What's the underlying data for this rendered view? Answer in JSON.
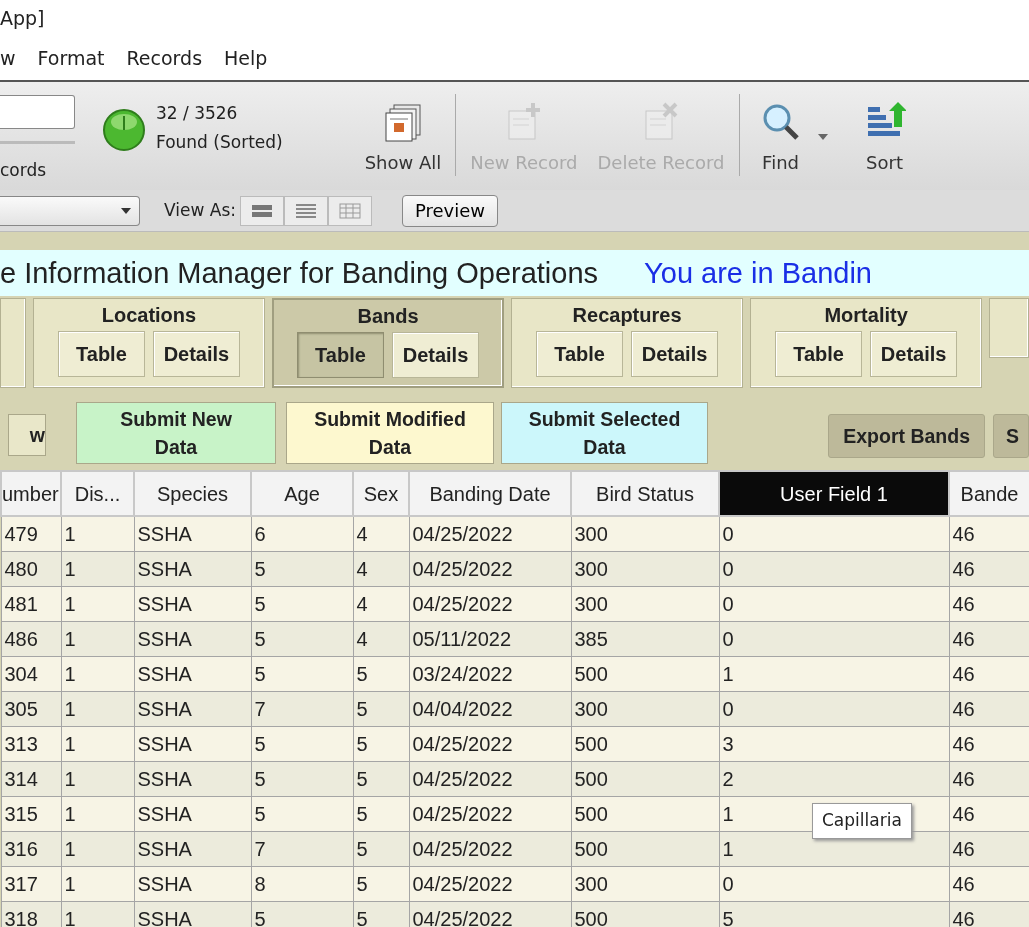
{
  "window": {
    "title": "App]"
  },
  "menu": [
    {
      "label": "w"
    },
    {
      "label": "Format"
    },
    {
      "label": "Records"
    },
    {
      "label": "Help"
    }
  ],
  "toolbar": {
    "search_label": "cords",
    "record_count": "32 / 3526",
    "found_status": "Found (Sorted)",
    "buttons": [
      {
        "kind": "show-all",
        "label": "Show All",
        "disabled": false
      },
      {
        "kind": "new",
        "label": "New Record",
        "disabled": true
      },
      {
        "kind": "delete",
        "label": "Delete Record",
        "disabled": true
      },
      {
        "kind": "find",
        "label": "Find",
        "disabled": false
      },
      {
        "kind": "sort",
        "label": "Sort",
        "disabled": false
      }
    ]
  },
  "layout_bar": {
    "view_as_label": "View As:",
    "preview": "Preview"
  },
  "banner": {
    "title": "e Information Manager for Banding Operations",
    "location": "You are in Bandin"
  },
  "nav_groups": [
    {
      "label": "Locations",
      "selected": false,
      "buttons": [
        {
          "label": "Table",
          "selected": false
        },
        {
          "label": "Details",
          "selected": false
        }
      ]
    },
    {
      "label": "Bands",
      "selected": true,
      "buttons": [
        {
          "label": "Table",
          "selected": true
        },
        {
          "label": "Details",
          "selected": false
        }
      ]
    },
    {
      "label": "Recaptures",
      "selected": false,
      "buttons": [
        {
          "label": "Table",
          "selected": false
        },
        {
          "label": "Details",
          "selected": false
        }
      ]
    },
    {
      "label": "Mortality",
      "selected": false,
      "buttons": [
        {
          "label": "Table",
          "selected": false
        },
        {
          "label": "Details",
          "selected": false
        }
      ]
    }
  ],
  "actions": {
    "left": [
      {
        "label": "w",
        "color": "#e9e7c9"
      },
      {
        "label": "Submit New Data",
        "color": "#c8f3c8"
      },
      {
        "label": "Submit Modified Data",
        "color": "#fdf8cf"
      },
      {
        "label": "Submit Selected Data",
        "color": "#ccf7fb"
      }
    ],
    "right": [
      {
        "label": "Export Bands",
        "color": "#bdb99a"
      },
      {
        "label": "S",
        "color": "#bdb99a"
      }
    ]
  },
  "table": {
    "columns": [
      {
        "label": "umber",
        "selected": false
      },
      {
        "label": "Dis...",
        "selected": false
      },
      {
        "label": "Species",
        "selected": false
      },
      {
        "label": "Age",
        "selected": false
      },
      {
        "label": "Sex",
        "selected": false
      },
      {
        "label": "Banding Date",
        "selected": false
      },
      {
        "label": "Bird Status",
        "selected": false
      },
      {
        "label": "User Field 1",
        "selected": true
      },
      {
        "label": "Bande",
        "selected": false
      }
    ],
    "rows": [
      [
        "479",
        "1",
        "SSHA",
        "6",
        "4",
        "04/25/2022",
        "300",
        "0",
        "46"
      ],
      [
        "480",
        "1",
        "SSHA",
        "5",
        "4",
        "04/25/2022",
        "300",
        "0",
        "46"
      ],
      [
        "481",
        "1",
        "SSHA",
        "5",
        "4",
        "04/25/2022",
        "300",
        "0",
        "46"
      ],
      [
        "486",
        "1",
        "SSHA",
        "5",
        "4",
        "05/11/2022",
        "385",
        "0",
        "46"
      ],
      [
        "304",
        "1",
        "SSHA",
        "5",
        "5",
        "03/24/2022",
        "500",
        "1",
        "46"
      ],
      [
        "305",
        "1",
        "SSHA",
        "7",
        "5",
        "04/04/2022",
        "300",
        "0",
        "46"
      ],
      [
        "313",
        "1",
        "SSHA",
        "5",
        "5",
        "04/25/2022",
        "500",
        "3",
        "46"
      ],
      [
        "314",
        "1",
        "SSHA",
        "5",
        "5",
        "04/25/2022",
        "500",
        "2",
        "46"
      ],
      [
        "315",
        "1",
        "SSHA",
        "5",
        "5",
        "04/25/2022",
        "500",
        "1",
        "46"
      ],
      [
        "316",
        "1",
        "SSHA",
        "7",
        "5",
        "04/25/2022",
        "500",
        "1",
        "46"
      ],
      [
        "317",
        "1",
        "SSHA",
        "8",
        "5",
        "04/25/2022",
        "300",
        "0",
        "46"
      ],
      [
        "318",
        "1",
        "SSHA",
        "5",
        "5",
        "04/25/2022",
        "500",
        "5",
        "46"
      ]
    ]
  },
  "tooltip": "Capillaria"
}
